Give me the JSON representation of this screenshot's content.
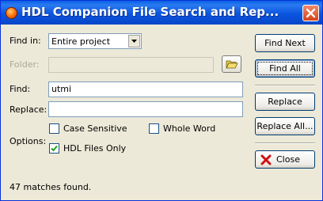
{
  "window": {
    "title": "HDL Companion File Search and Rep..."
  },
  "form": {
    "find_in_label": "Find in:",
    "find_in_value": "Entire project",
    "folder_label": "Folder:",
    "folder_value": "",
    "find_label": "Find:",
    "find_value": "utmi",
    "replace_label": "Replace:",
    "replace_value": "",
    "options_label": "Options:",
    "case_sensitive_label": "Case Sensitive",
    "case_sensitive_checked": false,
    "whole_word_label": "Whole Word",
    "whole_word_checked": false,
    "hdl_only_label": "HDL Files Only",
    "hdl_only_checked": true
  },
  "buttons": {
    "find_next": "Find Next",
    "find_all": "Find All",
    "replace": "Replace",
    "replace_all": "Replace All...",
    "close": "Close"
  },
  "status": {
    "text": "47 matches found."
  },
  "colors": {
    "titlebar": "#0a55df",
    "background": "#ece9d8",
    "close_red": "#d5431c",
    "field_border": "#7f9db9"
  },
  "icons": {
    "app": "app-icon",
    "window_close": "window-close-icon",
    "folder_browse": "open-folder-icon",
    "close_button": "red-x-icon"
  }
}
